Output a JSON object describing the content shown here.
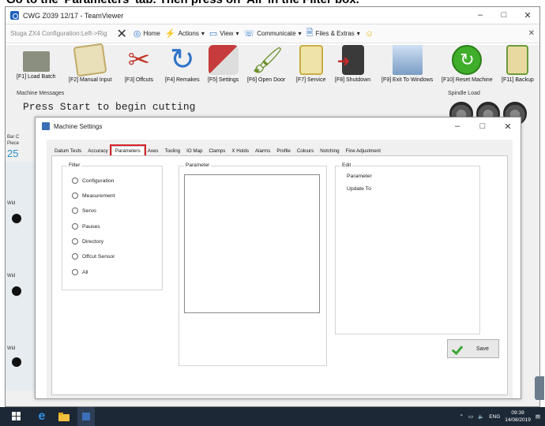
{
  "caption": "Go to the 'Parameters' tab. Then press on 'All' in the Filter box.",
  "teamviewer": {
    "title": "CWG Z039 12/17 - TeamViewer",
    "controls": [
      "–",
      "□",
      "✕"
    ],
    "toolbar": {
      "app_label": "Stuga ZX4   Configuration:Left->Rig",
      "home": "Home",
      "actions": "Actions",
      "view": "View",
      "communicate": "Communicate",
      "files": "Files & Extras",
      "close": "✕"
    }
  },
  "function_buttons": [
    {
      "label": "[F1] Load Batch",
      "icon": "folder-icon",
      "color": "#8a8f80"
    },
    {
      "label": "[F2] Manual Input",
      "icon": "notepad-icon",
      "color": "#c2aa67"
    },
    {
      "label": "[F3] Offcuts",
      "icon": "scissors-icon",
      "color": "#c0392b"
    },
    {
      "label": "[F4] Remakes",
      "icon": "redo-arrow-icon",
      "color": "#2f74c8"
    },
    {
      "label": "[F5] Settings",
      "icon": "tools-icon",
      "color": "#c63b3b"
    },
    {
      "label": "[F6] Open Door",
      "icon": "brush-icon",
      "color": "#6a8f2a"
    },
    {
      "label": "[F7] Service",
      "icon": "service-icon",
      "color": "#c7ae45"
    },
    {
      "label": "[F8] Shutdown",
      "icon": "exit-door-icon",
      "color": "#c62828"
    },
    {
      "label": "[F9] Exit To Windows",
      "icon": "windows-icon",
      "color": "#7a9cc4"
    },
    {
      "label": "[F10] Reset Machine",
      "icon": "reset-icon",
      "color": "#3fae2a"
    },
    {
      "label": "[F11] Backup",
      "icon": "backup-icon",
      "color": "#6a9a3a"
    }
  ],
  "machine_messages": {
    "title": "Machine Messages",
    "text": "Press Start to begin cutting"
  },
  "spindle_load": "Spindle Load",
  "side": {
    "bar_label": "Bar C",
    "piece_label": "Piece",
    "big_number": "25",
    "small_labels": [
      "Wid",
      "Wid",
      "Wid"
    ]
  },
  "dialog": {
    "title": "Machine Settings",
    "controls": [
      "–",
      "□",
      "✕"
    ],
    "tabs": [
      "Datum Tests",
      "Accuracy",
      "Parameters",
      "Axes",
      "Tooling",
      "IO Map",
      "Clamps",
      "X Holds",
      "Alarms",
      "Profile",
      "Colours",
      "Notching",
      "Fine Adjustment"
    ],
    "active_tab": "Parameters",
    "filter": {
      "title": "Filter",
      "options": [
        "Configuration",
        "Measurement",
        "Servo",
        "Pauses",
        "Directory",
        "Offcut Sensor",
        "All"
      ]
    },
    "parameter": {
      "title": "Parameter"
    },
    "edit": {
      "title": "Edit",
      "parameter_label": "Parameter",
      "update_label": "Update To"
    },
    "save_label": "Save"
  },
  "taskbar": {
    "language": "ENG",
    "time": "09:39",
    "date": "14/08/2019"
  },
  "colors": {
    "highlight": "#d8242a",
    "taskbar": "#1d2836",
    "accent_blue": "#2d8fc7"
  }
}
